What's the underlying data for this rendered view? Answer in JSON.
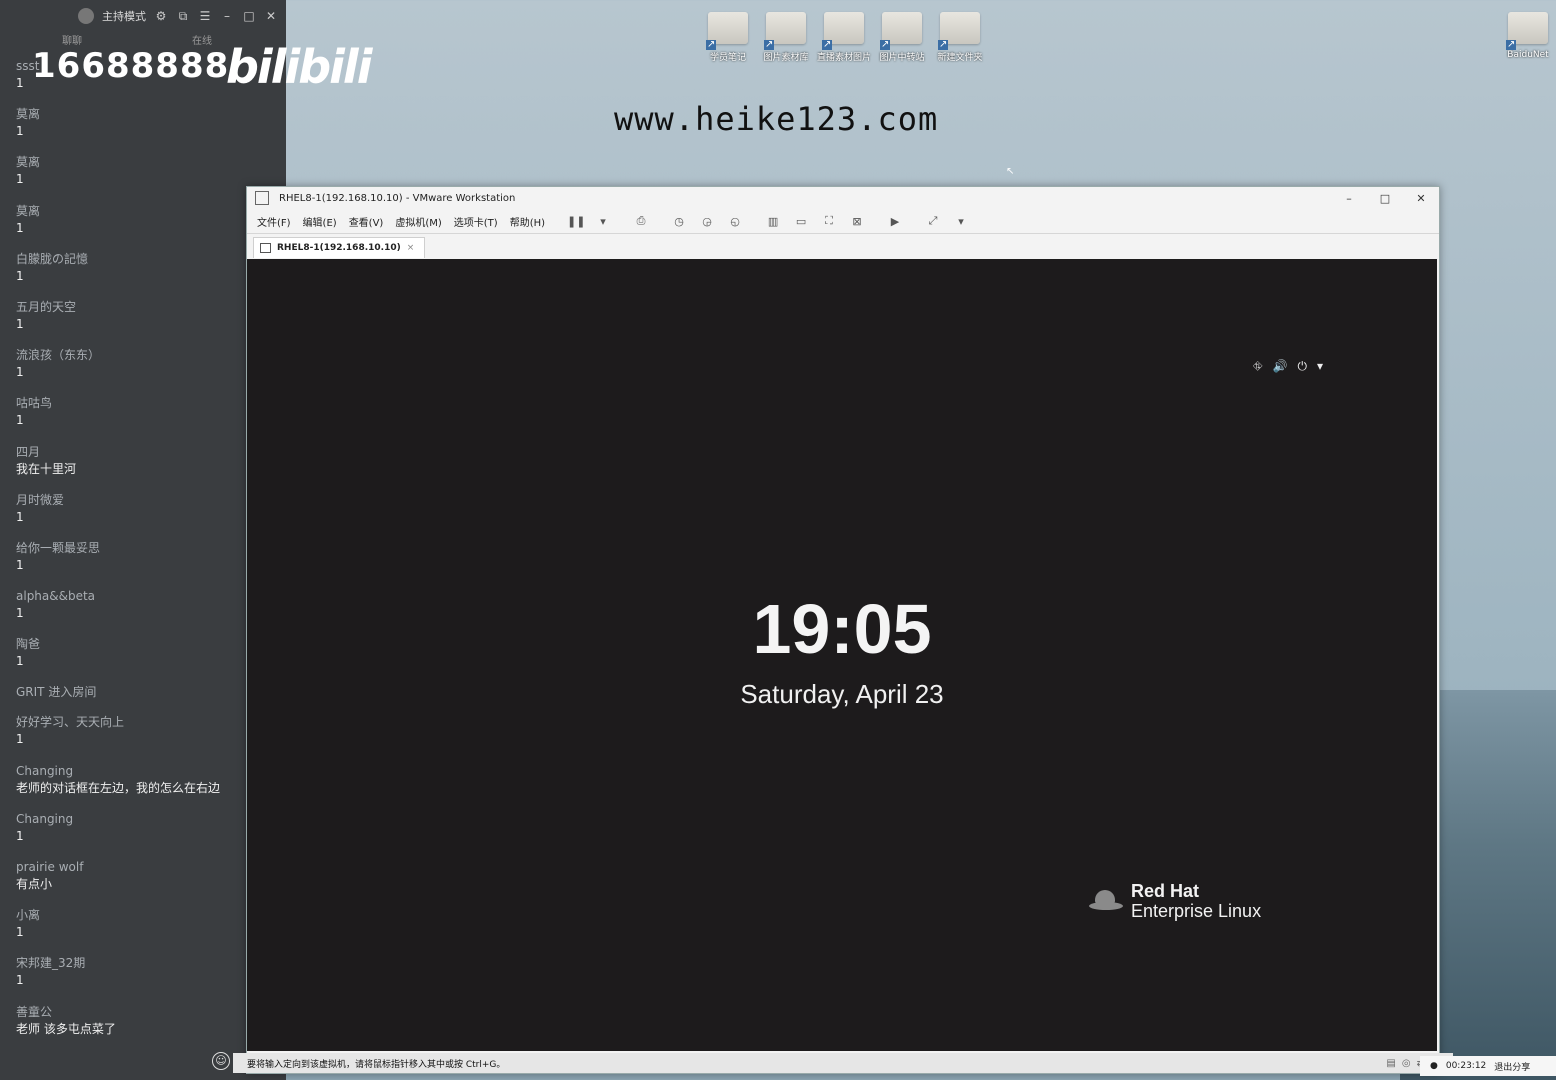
{
  "desktop": {
    "icons": [
      {
        "label": "学员笔记"
      },
      {
        "label": "图片素材库"
      },
      {
        "label": "直播素材图片"
      },
      {
        "label": "图片中转站"
      },
      {
        "label": "新建文件夹"
      },
      {
        "label": "BaiduNet"
      }
    ],
    "watermark_url": "www.heike123.com"
  },
  "chat": {
    "mode_label": "主持模式",
    "tabs": [
      "聊聊",
      "在线"
    ],
    "room_id": "16688888",
    "logo_text": "bilibili",
    "messages": [
      {
        "user": "ssst",
        "text": "1"
      },
      {
        "user": "莫离",
        "text": "1"
      },
      {
        "user": "莫离",
        "text": "1"
      },
      {
        "user": "莫离",
        "text": "1"
      },
      {
        "user": "白朦胧の記憶",
        "text": "1"
      },
      {
        "user": "五月的天空",
        "text": "1"
      },
      {
        "user": "流浪孩（东东）",
        "text": "1"
      },
      {
        "user": "咕咕鸟",
        "text": "1"
      },
      {
        "user": "四月",
        "text": "我在十里河"
      },
      {
        "user": "月时微爱",
        "text": "1"
      },
      {
        "user": "给你一颗最妥思",
        "text": "1"
      },
      {
        "user": "alpha&&beta",
        "text": "1"
      },
      {
        "user": "陶爸",
        "text": "1"
      },
      {
        "user": "GRIT 进入房间",
        "text": ""
      },
      {
        "user": "好好学习、天天向上",
        "text": "1"
      },
      {
        "user": "Changing",
        "text": "老师的对话框在左边，我的怎么在右边"
      },
      {
        "user": "Changing",
        "text": "1"
      },
      {
        "user": "prairie wolf",
        "text": "有点小"
      },
      {
        "user": "小离",
        "text": "1"
      },
      {
        "user": "宋邦建_32期",
        "text": "1"
      },
      {
        "user": "善童公",
        "text": "老师  该多屯点菜了"
      }
    ]
  },
  "vmware": {
    "title": "RHEL8-1(192.168.10.10) - VMware Workstation",
    "menu": [
      "文件(F)",
      "编辑(E)",
      "查看(V)",
      "虚拟机(M)",
      "选项卡(T)",
      "帮助(H)"
    ],
    "tab_label": "RHEL8-1(192.168.10.10)",
    "status_text": "要将输入定向到该虚拟机，请将鼠标指针移入其中或按 Ctrl+G。",
    "guest": {
      "time": "19:05",
      "date": "Saturday, April 23",
      "brand_line1": "Red Hat",
      "brand_line2": "Enterprise Linux"
    }
  },
  "recorder": {
    "elapsed": "00:23:12",
    "exit_label": "退出分享"
  }
}
